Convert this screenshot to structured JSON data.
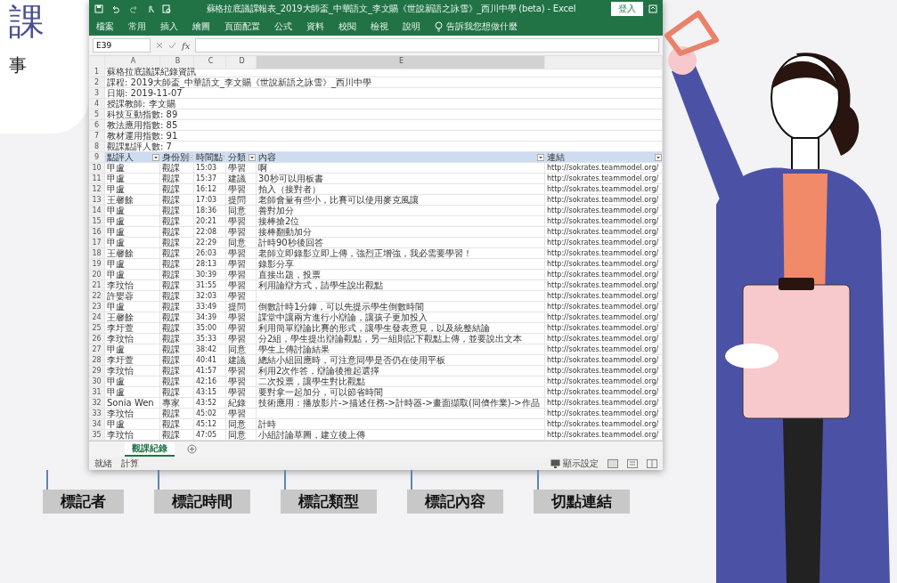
{
  "heading": {
    "title": "課",
    "subtitle": "事"
  },
  "excel": {
    "title": "蘇格拉底議課報表_2019大師盃_中華語文_李文賜《世說新語之詠雪》_西川中學 (beta)  -  Excel",
    "sign_in": "登入",
    "ribbon_tabs": [
      "檔案",
      "常用",
      "插入",
      "繪圖",
      "頁面配置",
      "公式",
      "資料",
      "校閱",
      "檢視",
      "說明"
    ],
    "tell_me": "告訴我您想做什麼",
    "name_box": "E39",
    "function_label": "fx",
    "column_headers": [
      "A",
      "B",
      "C",
      "D",
      "E"
    ],
    "info_rows": [
      {
        "row": "1",
        "text": "蘇格拉底議課紀錄資訊"
      },
      {
        "row": "2",
        "text": "課程: 2019大師盃_中華語文_李文賜《世說新語之詠雪》_西川中學"
      },
      {
        "row": "3",
        "text": "日期: 2019-11-07"
      },
      {
        "row": "4",
        "text": "授課教師: 李文賜"
      },
      {
        "row": "5",
        "text": "科技互動指數: 89"
      },
      {
        "row": "6",
        "text": "教法應用指數: 85"
      },
      {
        "row": "7",
        "text": "教材運用指數: 91"
      },
      {
        "row": "8",
        "text": "觀課點評人數: 7"
      }
    ],
    "header": {
      "row": "9",
      "cells": [
        "點評人",
        "身份別",
        "時間點",
        "分類",
        "內容",
        "連結"
      ]
    },
    "rows": [
      {
        "row": "10",
        "cells": [
          "甲盧",
          "觀課",
          "15:03",
          "學習",
          "啊",
          "http://sokrates.teammodel.org/"
        ]
      },
      {
        "row": "11",
        "cells": [
          "甲盧",
          "觀課",
          "15:37",
          "建議",
          "30秒可以用板書",
          "http://sokrates.teammodel.org/"
        ]
      },
      {
        "row": "12",
        "cells": [
          "甲盧",
          "觀課",
          "16:12",
          "學習",
          "拍入（接對者）",
          "http://sokrates.teammodel.org/"
        ]
      },
      {
        "row": "13",
        "cells": [
          "王馨餘",
          "觀課",
          "17:03",
          "提問",
          "老師會量有些小，比賽可以使用麥克風讓",
          "http://sokrates.teammodel.org/"
        ]
      },
      {
        "row": "14",
        "cells": [
          "甲盧",
          "觀課",
          "18:36",
          "同意",
          "善對加分",
          "http://sokrates.teammodel.org/"
        ]
      },
      {
        "row": "15",
        "cells": [
          "甲盧",
          "觀課",
          "20:21",
          "學習",
          "接棒搶2位",
          "http://sokrates.teammodel.org/"
        ]
      },
      {
        "row": "16",
        "cells": [
          "甲盧",
          "觀課",
          "22:08",
          "學習",
          "接棒翻動加分",
          "http://sokrates.teammodel.org/"
        ]
      },
      {
        "row": "17",
        "cells": [
          "甲盧",
          "觀課",
          "22:29",
          "同意",
          "計時90秒後回答",
          "http://sokrates.teammodel.org/"
        ]
      },
      {
        "row": "18",
        "cells": [
          "王馨餘",
          "觀課",
          "26:03",
          "學習",
          "老師立即錄影立即上傳，強烈正增強，我必需要學習！",
          "http://sokrates.teammodel.org/"
        ]
      },
      {
        "row": "19",
        "cells": [
          "甲盧",
          "觀課",
          "28:13",
          "學習",
          "錄影分享",
          "http://sokrates.teammodel.org/"
        ]
      },
      {
        "row": "20",
        "cells": [
          "甲盧",
          "觀課",
          "30:39",
          "學習",
          "直接出題，投票",
          "http://sokrates.teammodel.org/"
        ]
      },
      {
        "row": "21",
        "cells": [
          "李玟怡",
          "觀課",
          "31:55",
          "學習",
          "利用論辯方式，請學生說出觀點",
          "http://sokrates.teammodel.org/"
        ]
      },
      {
        "row": "22",
        "cells": [
          "許嬰蓉",
          "觀課",
          "32:03",
          "學習",
          "",
          "http://sokrates.teammodel.org/"
        ]
      },
      {
        "row": "23",
        "cells": [
          "甲盧",
          "觀課",
          "33:49",
          "提問",
          "倒數計時1分鐘，可以先提示學生倒數時間",
          "http://sokrates.teammodel.org/"
        ]
      },
      {
        "row": "24",
        "cells": [
          "王馨餘",
          "觀課",
          "34:39",
          "學習",
          "課堂中讓兩方進行小辯論，讓孩子更加投入",
          "http://sokrates.teammodel.org/"
        ]
      },
      {
        "row": "25",
        "cells": [
          "李圩萱",
          "觀課",
          "35:00",
          "學習",
          "利用簡單辯論比賽的形式，讓學生發表意見，以及統整結論",
          "http://sokrates.teammodel.org/"
        ]
      },
      {
        "row": "26",
        "cells": [
          "李玟怡",
          "觀課",
          "35:33",
          "學習",
          "分2組，學生提出辯論觀點，另一組則記下觀點上傳，並要說出文本",
          "http://sokrates.teammodel.org/"
        ]
      },
      {
        "row": "27",
        "cells": [
          "甲盧",
          "觀課",
          "38:42",
          "同意",
          "學生上傳討論結果",
          "http://sokrates.teammodel.org/"
        ]
      },
      {
        "row": "28",
        "cells": [
          "李圩萱",
          "觀課",
          "40:41",
          "建議",
          "總結小組回應時，可注意同學是否仍在使用平板",
          "http://sokrates.teammodel.org/"
        ]
      },
      {
        "row": "29",
        "cells": [
          "李玟怡",
          "觀課",
          "41:57",
          "學習",
          "利用2次作答，辯論後推起選擇",
          "http://sokrates.teammodel.org/"
        ]
      },
      {
        "row": "30",
        "cells": [
          "甲盧",
          "觀課",
          "42:16",
          "學習",
          "二次投票，讓學生對比觀點",
          "http://sokrates.teammodel.org/"
        ]
      },
      {
        "row": "31",
        "cells": [
          "甲盧",
          "觀課",
          "43:15",
          "學習",
          "要對拿一起加分，可以節省時間",
          "http://sokrates.teammodel.org/"
        ]
      },
      {
        "row": "32",
        "cells": [
          "Sonia Wen",
          "專家",
          "43:52",
          "紀錄",
          "技術應用：播放影片->描述任務->計時器->畫面擷取(同儕作業)->作品",
          "http://sokrates.teammodel.org/"
        ]
      },
      {
        "row": "33",
        "cells": [
          "李玟怡",
          "觀課",
          "45:02",
          "學習",
          "",
          "http://sokrates.teammodel.org/"
        ]
      },
      {
        "row": "34",
        "cells": [
          "甲盧",
          "觀課",
          "45:12",
          "同意",
          "計時",
          "http://sokrates.teammodel.org/"
        ]
      },
      {
        "row": "35",
        "cells": [
          "李玟怡",
          "觀課",
          "47:05",
          "同意",
          "小組討論草圖，建立後上傳",
          "http://sokrates.teammodel.org/"
        ]
      }
    ],
    "sheet_tabs": [
      {
        "label": "觀課紀錄",
        "selected": true
      }
    ],
    "status": [
      "就緒",
      "計算"
    ],
    "display_settings": "顯示設定"
  },
  "callouts": [
    "標記者",
    "標記時間",
    "標記類型",
    "標記內容",
    "切點連結"
  ]
}
